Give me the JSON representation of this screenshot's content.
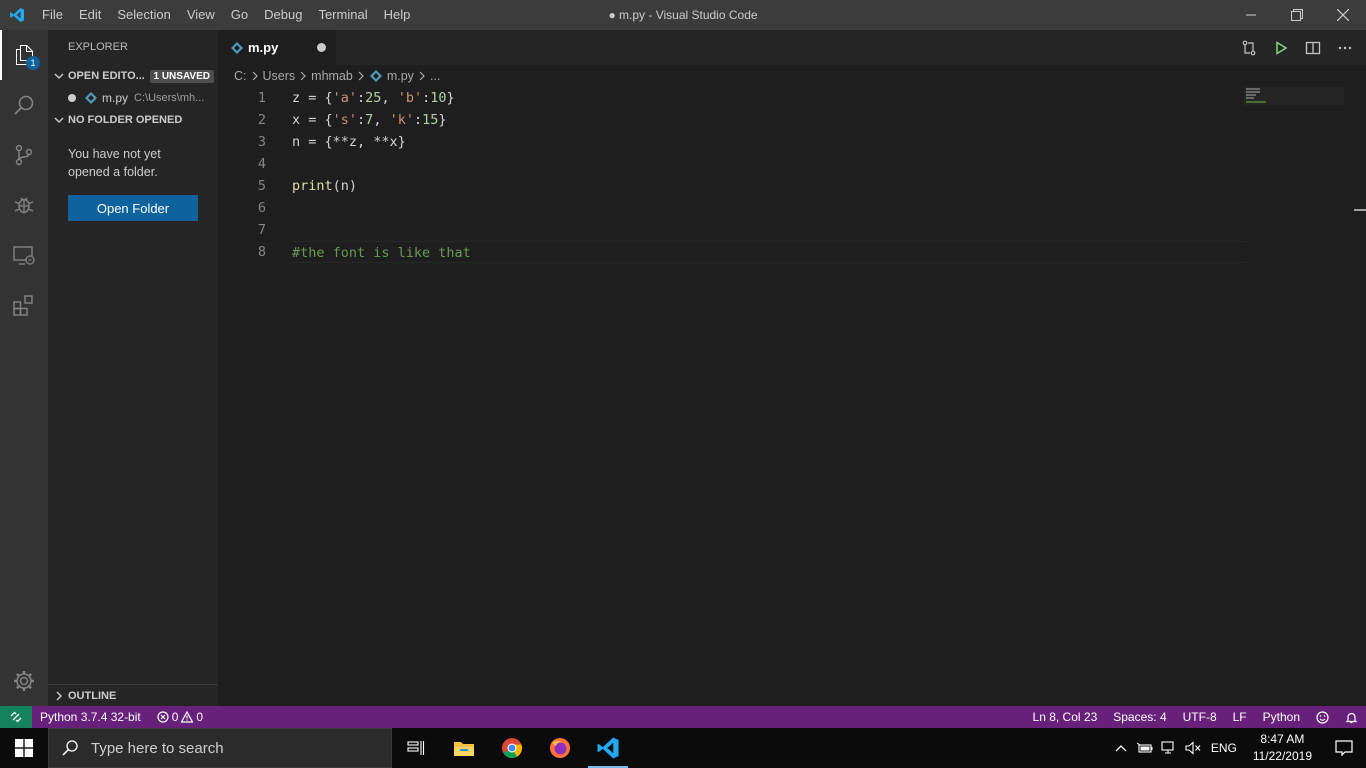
{
  "titlebar": {
    "menu": [
      "File",
      "Edit",
      "Selection",
      "View",
      "Go",
      "Debug",
      "Terminal",
      "Help"
    ],
    "title": "● m.py - Visual Studio Code"
  },
  "activity": {
    "badge": "1",
    "icons": [
      "files-icon",
      "search-icon",
      "source-control-icon",
      "debug-icon",
      "remote-explorer-icon",
      "extensions-icon",
      "settings-gear-icon"
    ]
  },
  "sidebar": {
    "title": "EXPLORER",
    "open_editors_label": "OPEN EDITO...",
    "unsaved_badge": "1 UNSAVED",
    "open_editor_file": "m.py",
    "open_editor_path": "C:\\Users\\mh...",
    "no_folder_label": "NO FOLDER OPENED",
    "no_folder_message": "You have not yet opened a folder.",
    "open_folder_button": "Open Folder",
    "outline_label": "OUTLINE"
  },
  "tab": {
    "label": "m.py"
  },
  "breadcrumb": [
    "C:",
    "Users",
    "mhmab",
    "m.py",
    "..."
  ],
  "editor": {
    "line_numbers": [
      "1",
      "2",
      "3",
      "4",
      "5",
      "6",
      "7",
      "8"
    ],
    "current_line": 8
  },
  "statusbar": {
    "interpreter": "Python 3.7.4 32-bit",
    "errors": "0",
    "warnings": "0",
    "cursor": "Ln 8, Col 23",
    "spaces": "Spaces: 4",
    "encoding": "UTF-8",
    "eol": "LF",
    "language": "Python"
  },
  "taskbar": {
    "search_placeholder": "Type here to search",
    "language": "ENG",
    "time": "8:47 AM",
    "date": "11/22/2019"
  },
  "colors": {
    "statusbar": "#68217a",
    "remote": "#16825d",
    "button": "#0e639c",
    "string": "#ce9178",
    "number": "#b5cea8",
    "function": "#dcdcaa",
    "comment": "#6a9955"
  }
}
